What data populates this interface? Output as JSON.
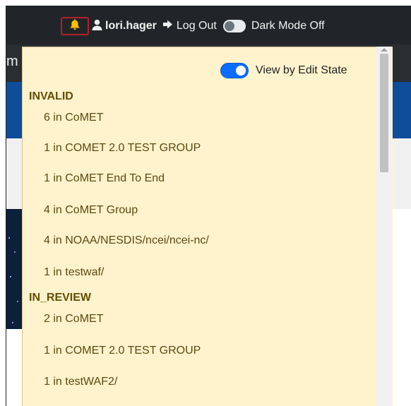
{
  "navbar": {
    "username": "lori.hager",
    "logout_label": "Log Out",
    "dark_mode_label": "Dark Mode Off"
  },
  "background": {
    "partial_text": "m"
  },
  "dropdown": {
    "view_toggle_label": "View by Edit State",
    "view_toggle_on": true,
    "sections": [
      {
        "title": "INVALID",
        "items": [
          "6 in CoMET",
          "1 in COMET 2.0 TEST GROUP",
          "1 in CoMET End To End",
          "4 in CoMET Group",
          "4 in NOAA/NESDIS/ncei/ncei-nc/",
          "1 in testwaf/"
        ]
      },
      {
        "title": "IN_REVIEW",
        "items": [
          "2 in CoMET",
          "1 in COMET 2.0 TEST GROUP",
          "1 in testWAF2/"
        ]
      }
    ]
  },
  "colors": {
    "navbar_bg": "#212529",
    "dropdown_bg": "#fff3cd",
    "bell": "#ffc107",
    "toggle_on": "#0d6efd",
    "section_heading": "#664d03"
  }
}
